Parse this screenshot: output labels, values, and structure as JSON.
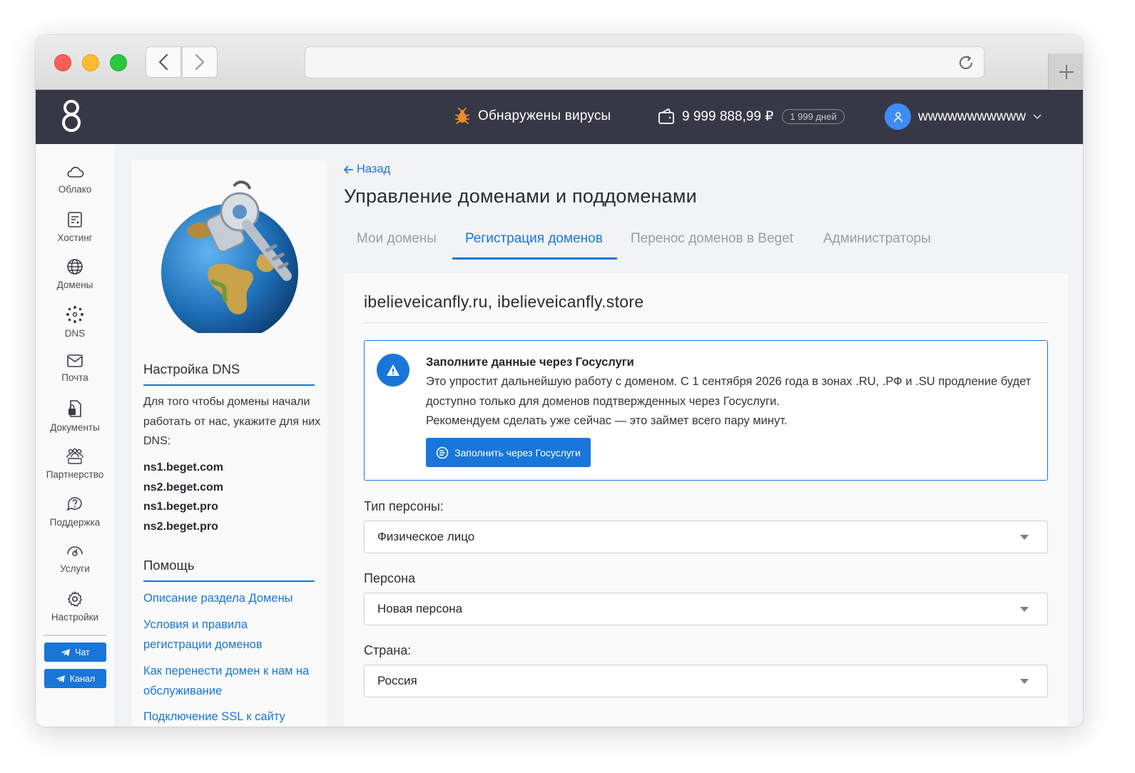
{
  "header": {
    "virus_text": "Обнаружены вирусы",
    "balance": "9 999 888,99 ₽",
    "days": "1 999 дней",
    "username": "wwwwwwwwwww"
  },
  "sidebar": {
    "items": [
      {
        "label": "Облако",
        "icon": "cloud-icon"
      },
      {
        "label": "Хостинг",
        "icon": "server-icon"
      },
      {
        "label": "Домены",
        "icon": "globe-icon"
      },
      {
        "label": "DNS",
        "icon": "dns-icon"
      },
      {
        "label": "Почта",
        "icon": "mail-icon"
      },
      {
        "label": "Документы",
        "icon": "document-icon"
      },
      {
        "label": "Партнерство",
        "icon": "partners-icon"
      },
      {
        "label": "Поддержка",
        "icon": "support-icon"
      },
      {
        "label": "Услуги",
        "icon": "services-icon"
      },
      {
        "label": "Настройки",
        "icon": "gear-icon"
      }
    ],
    "chat_label": "Чат",
    "channel_label": "Канал"
  },
  "left_panel": {
    "dns_title": "Настройка DNS",
    "dns_text": "Для того чтобы домены начали работать от нас, укажите для них DNS:",
    "nameservers": [
      "ns1.beget.com",
      "ns2.beget.com",
      "ns1.beget.pro",
      "ns2.beget.pro"
    ],
    "help_title": "Помощь",
    "help_links": [
      "Описание раздела Домены",
      "Условия и правила регистрации доменов",
      "Как перенести домен к нам на обслуживание",
      "Подключение SSL к сайту"
    ]
  },
  "main": {
    "back_label": "Назад",
    "title": "Управление доменами и поддоменами",
    "tabs": [
      {
        "label": "Мои домены",
        "active": false
      },
      {
        "label": "Регистрация доменов",
        "active": true
      },
      {
        "label": "Перенос доменов в Beget",
        "active": false
      },
      {
        "label": "Администраторы",
        "active": false
      }
    ],
    "domains": "ibelieveicanfly.ru, ibelieveicanfly.store",
    "alert": {
      "title": "Заполните данные через Госуслуги",
      "text": "Это упростит дальнейшую работу с доменом. С 1 сентября 2026 года в зонах .RU, .РФ и .SU продление будет доступно только для доменов подтвержденных через Госуслуги.",
      "text2": "Рекомендуем сделать уже сейчас — это займет всего пару минут.",
      "button": "Заполнить через Госуслуги"
    },
    "form": {
      "person_type_label": "Тип персоны:",
      "person_type_value": "Физическое лицо",
      "person_label": "Персона",
      "person_value": "Новая персона",
      "country_label": "Страна:",
      "country_value": "Россия"
    }
  },
  "colors": {
    "accent": "#1976d8",
    "topbar": "#363945",
    "virus": "#f08a24"
  }
}
